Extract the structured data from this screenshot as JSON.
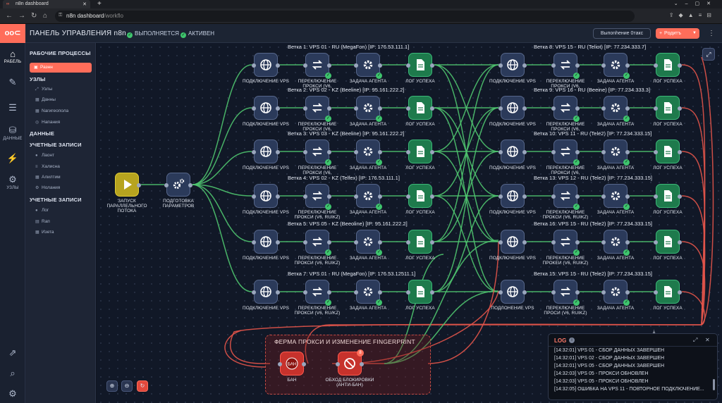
{
  "browser": {
    "tab_title": "n8n dashboard",
    "url_main": "n8n dashboard",
    "url_dim": "/workflo",
    "new_tab": "+"
  },
  "header": {
    "logo": "oo⊂",
    "title": "ПАНЕЛЬ УПРАВЛЕНИЯ n8n",
    "status_running": "ВЫПОЛНЯЕТСЯ",
    "status_active": "АКТИВЕН",
    "btn_outline": "Выпоnhение 0тaкс",
    "btn_primary": "Pодитъ"
  },
  "rail": {
    "items": [
      {
        "label": "РАБЕЛЬ"
      },
      {
        "label": ""
      },
      {
        "label": ""
      },
      {
        "label": "ДАННЫЕ"
      },
      {
        "label": ""
      },
      {
        "label": "УЗЛЫ"
      }
    ]
  },
  "sidebar": {
    "h_workflows": "РАБОЧИЕ ПРОЦЕССЫ",
    "selected": "Разнн",
    "h_nodes": "УЗЛЫ",
    "nodes_items": [
      "Узлы",
      "Данны",
      "Nагигеопола",
      "Напания"
    ],
    "h_data": "ДАННЫЕ",
    "h_accounts1": "УЧЕТНЫЕ ЗАПИСИ",
    "accounts1_items": [
      "Лаонт",
      "Халисна",
      "Алилтим",
      "Нолания"
    ],
    "h_accounts2": "УЧЕТНЫЕ ЗАПИСИ",
    "accounts2_items": [
      "Лог",
      "Rап",
      "Изета"
    ]
  },
  "canvas": {
    "trigger_label": "ЗАПУСК ПАРАЛЛЕЛЬНОГО ПОТОКА",
    "prep_label": "ПОДГОТОВКА ПАРАМЕТРОВ",
    "left_branches": [
      {
        "title": "Ветка 1: VPS 01 - RU (MegaFon) [IP: 176.53.111.1]",
        "n1": "ПОДКЛЮЧЕНИЕ VPS",
        "n2": "ПЕРЕКЛЮЧЕНИЕ ПРОКСИ (V6,",
        "n3": "ЗАДАЧА АГЕНТА",
        "n4": "ЛОГ УСПЕХА"
      },
      {
        "title": "Ветка 2: VPS 02 - KZ (Beeline) [IP: 95.161.222.2]",
        "n1": "ПОДКЛЮЧЕНИЕ VPS",
        "n2": "ПЕРЕКЛЮЧЕНИЕ ПРОКСИ (V6,",
        "n3": "ЗАДАЧА АГЕНТА",
        "n4": "ЛОГ УСПЕХА"
      },
      {
        "title": "Ветка 3: VPS 03 - KZ (Beeline) [IP: 95.161.222.2]",
        "n1": "ПОДКЛЮЧЕНИЕ VPS",
        "n2": "ПЕРЕКЛЮЧЕНИЕ ПРОКСИ (V6,",
        "n3": "ЗАДАЧА АГЕНТА",
        "n4": "ЛОГ УСПЕХА"
      },
      {
        "title": "Ветка 4: VPS 02 - KZ (Telfex) [IP: 176.53.111.1]",
        "n1": "ПОДКЛЮЧЕНИЕ VPS",
        "n2": "ПЕРЕКЛЮЧЕНИЕ ПРОКСИ (V6, RUIKZ)",
        "n3": "ЗАДАЧА АГЕНТА",
        "n4": "ЛОГ УСПЕХА"
      },
      {
        "title": "Ветка 5: VPS 05 - KZ (Beeoline) [IP: 95.161.222.2]",
        "n1": "ПОДКЛЮЧЕНИЕ VPS",
        "n2": "ПЕРЕКЛЮЧЕНИЕ ПРОКСИ (V6, RUIKZ)",
        "n3": "ЗАДАЧА АГЕНТА",
        "n4": "ЛОГ УСПЕХА"
      },
      {
        "title": "Ветка 7: VPS 01 - RU (MegaFon) [IP: 176.53.12511.1]",
        "n1": "ПОДКЛЮЧЕНИЕ VPS",
        "n2": "ПЕРЕКЛЮЧЕНИЕ ПРОКСИ (V6, RU/KZ)",
        "n3": "ЗАДАЧА АГЕНТА",
        "n4": "ЛОГ УСПЕХА"
      }
    ],
    "right_branches": [
      {
        "title": "Ветка 8: VPS 15 - RU (Teliot) [IP: 77.234.333.7]",
        "n1": "ПОДКЛЮЧЕНИЕ VPS",
        "n2": "ПЕРЕКЛЮЧЕНИЕ ПРОКСИ (V6,",
        "n3": "ЗАДАЧА АГЕНТА",
        "n4": "ЛОГ УСПЕХА"
      },
      {
        "title": "Ветка 9: VPS 16 - RU (Beeine) [IP: 77.234.333.3]",
        "n1": "ПОДКЛЮЧЕНИЕ VPS",
        "n2": "ПЕРЕКЛЮЧЕНИЕ ПРОКСИ (V6,",
        "n3": "ЗАДАЧА АГЕНТА",
        "n4": "ЛОГ УСПЕХА"
      },
      {
        "title": "Ветка 10: VPS 11 - RU (Tele2) [IP: 77.234.333.15]",
        "n1": "ПОДКЛЮЧЕНИЕ VPS",
        "n2": "ПЕРЕКЛЮЧЕНИЕ ПРОКСИ (V6,",
        "n3": "ЗАДАЧА АГЕНТА",
        "n4": "ЛОГ УСПЕХА"
      },
      {
        "title": "Ветка 13: VPS 12 - RU (Tele2) [IP: 77.234.333.15]",
        "n1": "ПОДКЛЮЧЕНИЕ VPS",
        "n2": "ПЕРЕКЛЮЧЕНИЕ ПРОКСИ (V6, RUIKZ)",
        "n3": "ЗАДАЧА АГЕНТА",
        "n4": "ЛОГ УСПЕХА"
      },
      {
        "title": "Ветка 16: VPS 15 - RU (Tele2) [IP: 77.234.333.15]",
        "n1": "ПОДКЛЮЧЕНИЕ VPS",
        "n2": "ПЕРЕКЛЮЧЕНИЕ ПРОКЕИ (V6, RUIKZ)",
        "n3": "ЗАДАЧА АГЕНТА",
        "n4": "ЛОГ УСПЕХА"
      },
      {
        "title": "Ветка 15: VPS 15 - RU (Tele2) [IP: 77.234.333.15]",
        "n1": "ПОДЛОНЕНИЕ VPS",
        "n2": "ПЕРЕКЛЮЧЕНИЕ ПРОСИ (V6, RUIKZ)",
        "n3": "ЗАДАЧА АГЕНТА",
        "n4": "ЛОГ УСПЕХА"
      }
    ],
    "farm_title": "ФЕРМА ПРОКСИ И ИЗМЕНЕНИЕ FINGERPRINT",
    "ban_label": "БАН",
    "ban_inner": "БАН",
    "bypass_label": "ОБХОД БЛОКИРОВКИ (АНТИ-БАН)",
    "bypass_badge": "8"
  },
  "log": {
    "title": "LOG",
    "lines": [
      "[14:32:01] VPS 01 - СБОР ДАННЫХ ЗАВЕРШЕН",
      "[14:32:01] VPS 02 - СБОР ДАННЫХ ЗАВЕРШЕН",
      "[14:32:01] VPS 05 - СБОР ДАННЫХ ЗАВЕРШЕН",
      "[14:32:03] VPS 05 - ПРОКСИ ОБНОВЛЕН",
      "[14:32:03] VPS 05 - ПРОКСИ ОБНОВЛЕН",
      "[14:32:05] ОШИБКА НА VPS 11 - ПОВТОРНОЕ ПОДКЛЮЧЕНИЕ..."
    ]
  },
  "icons": {
    "vps": "globe-icon",
    "proxy": "switch-icon",
    "agent": "gear-icon",
    "log": "document-icon",
    "trigger": "play-icon",
    "prep": "gears-icon",
    "ban": "stop-icon",
    "bypass": "prohibited-icon"
  },
  "colors": {
    "accent": "#ff6d5a",
    "success": "#3ec46d",
    "wire_green": "#4fc46f",
    "wire_red": "#e2544a",
    "node": "#2b3a5a",
    "node_log": "#1e7a4c",
    "trigger": "#b7a41f"
  }
}
